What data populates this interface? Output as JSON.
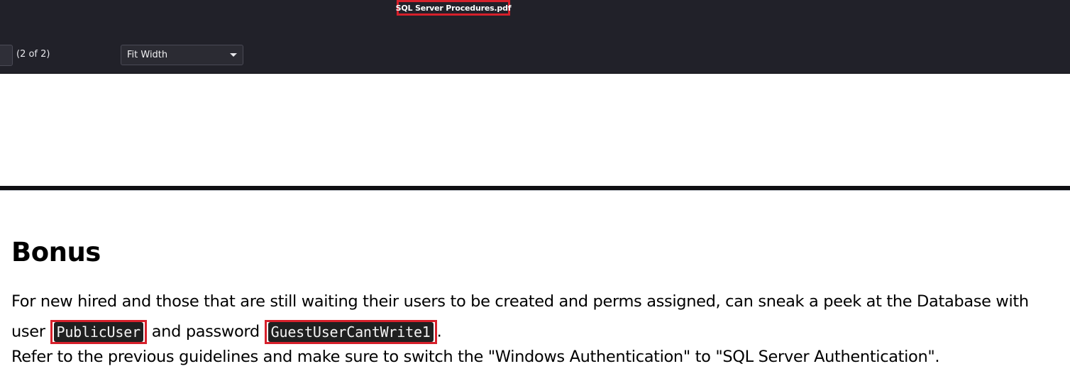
{
  "header": {
    "document_title": "SQL Server Procedures.pdf",
    "page_count": "(2 of 2)",
    "zoom": "Fit Width"
  },
  "content": {
    "heading": "Bonus",
    "line1": "For new hired and those that are still waiting their users to be created and perms assigned, can sneak a peek at the Database with",
    "line2_prefix": "user",
    "username": "PublicUser",
    "line2_middle": "and password",
    "password": "GuestUserCantWrite1",
    "line2_suffix": ".",
    "line3": "Refer to the previous guidelines and make sure to switch the \"Windows Authentication\" to \"SQL Server Authentication\"."
  },
  "colors": {
    "toolbar": "#212129",
    "highlight": "#d6202b",
    "code_bg": "#202020"
  }
}
